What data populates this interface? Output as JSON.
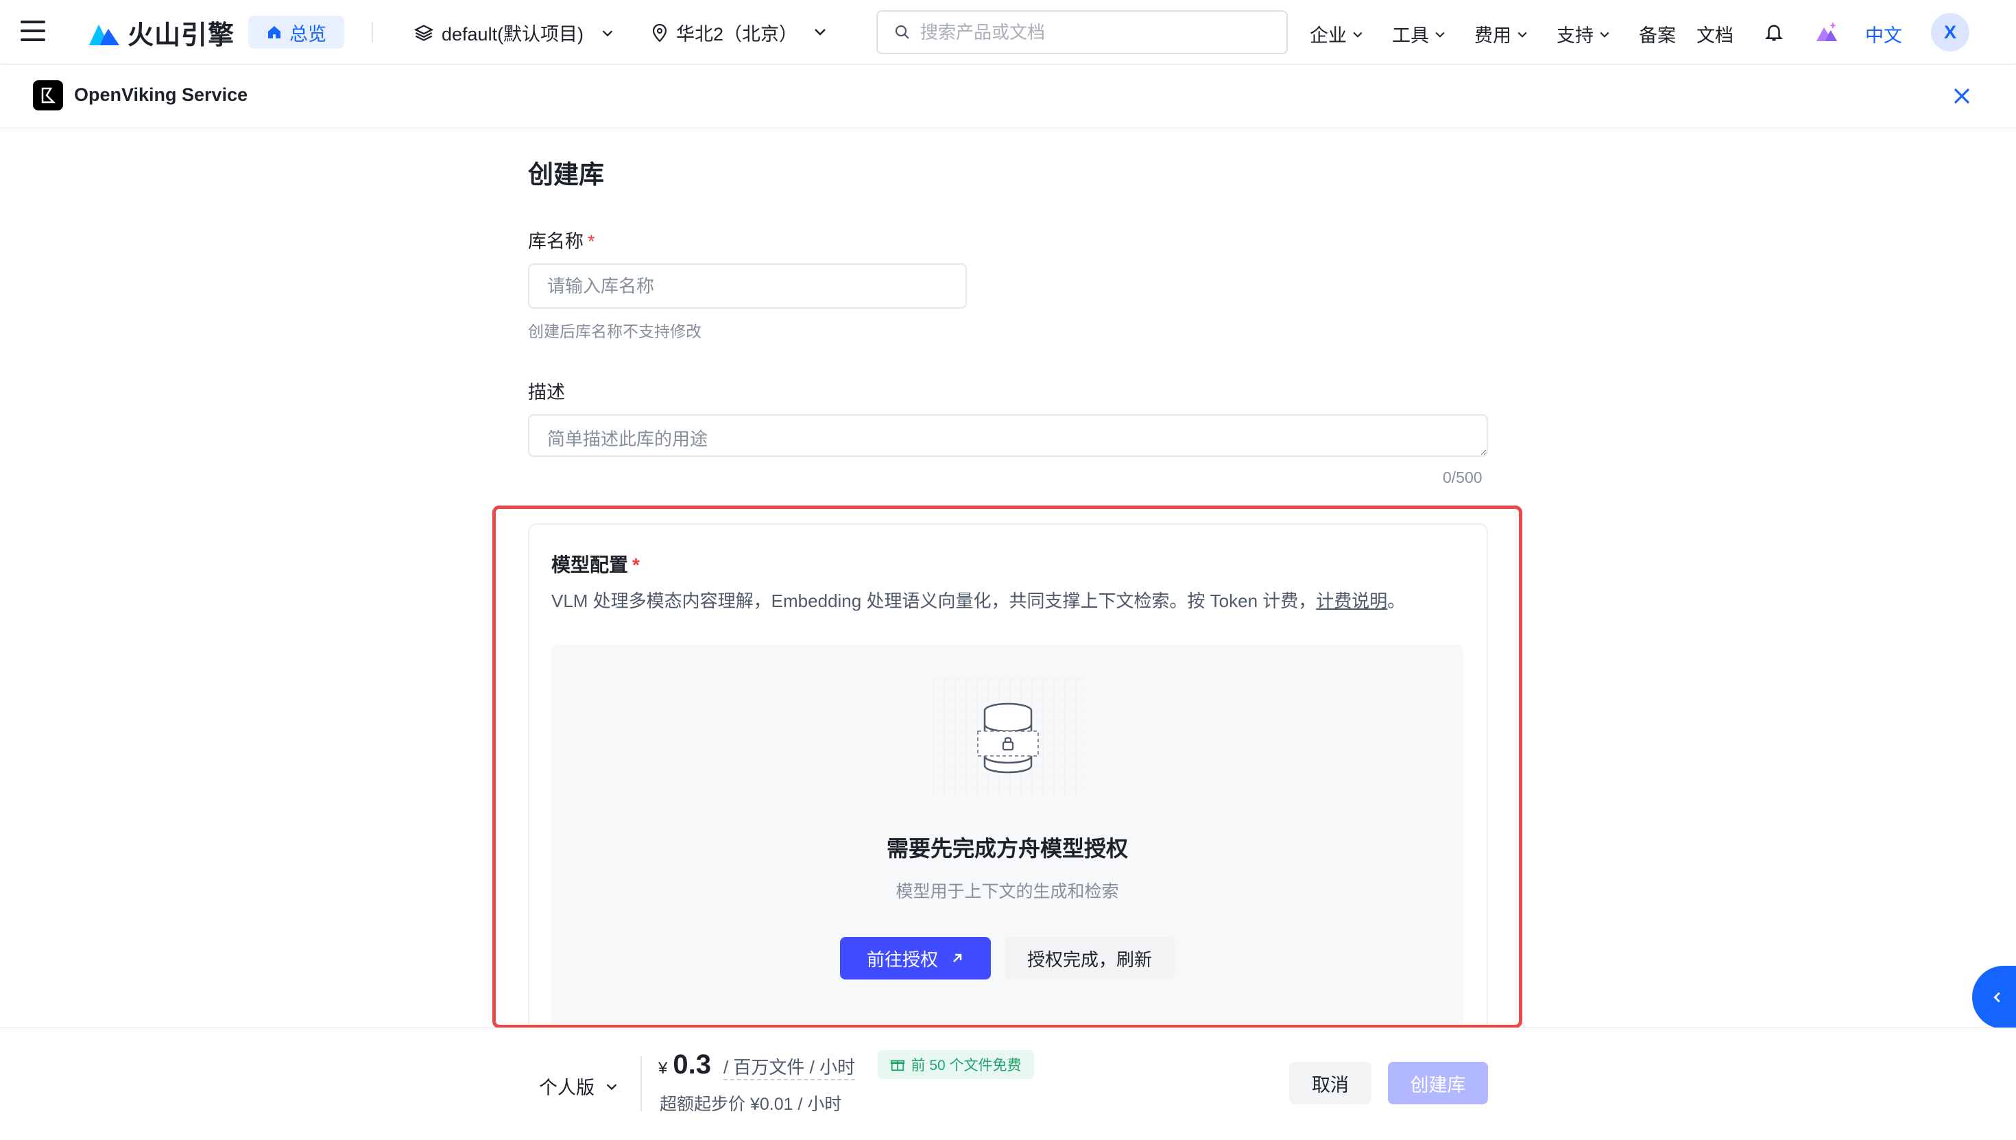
{
  "topbar": {
    "brand": "火山引擎",
    "home_label": "总览",
    "project": "default(默认项目)",
    "region": "华北2（北京）",
    "search_placeholder": "搜索产品或文档",
    "nav": [
      "企业",
      "工具",
      "费用",
      "支持",
      "备案",
      "文档"
    ],
    "language": "中文",
    "avatar_initial": "X"
  },
  "service": {
    "name": "OpenViking Service"
  },
  "form": {
    "title": "创建库",
    "name_label": "库名称",
    "name_placeholder": "请输入库名称",
    "name_hint": "创建后库名称不支持修改",
    "desc_label": "描述",
    "desc_placeholder": "简单描述此库的用途",
    "desc_counter": "0/500"
  },
  "model_config": {
    "title": "模型配置",
    "description": "VLM 处理多模态内容理解，Embedding 处理语义向量化，共同支撑上下文检索。按 Token 计费，",
    "pricing_link": "计费说明",
    "description_end": "。",
    "empty_title": "需要先完成方舟模型授权",
    "empty_subtitle": "模型用于上下文的生成和检索",
    "authorize_button": "前往授权",
    "refresh_button": "授权完成，刷新"
  },
  "footer": {
    "plan": "个人版",
    "currency": "¥",
    "price": "0.3",
    "unit": "/ 百万文件 / 小时",
    "free_tag": "前 50 个文件免费",
    "over_price": "超额起步价 ¥0.01 / 小时",
    "cancel": "取消",
    "create": "创建库"
  },
  "colors": {
    "accent": "#1664ff",
    "primary_button": "#3f4cff",
    "highlight_border": "#e84a4a",
    "free_tag_text": "#20a46b"
  }
}
